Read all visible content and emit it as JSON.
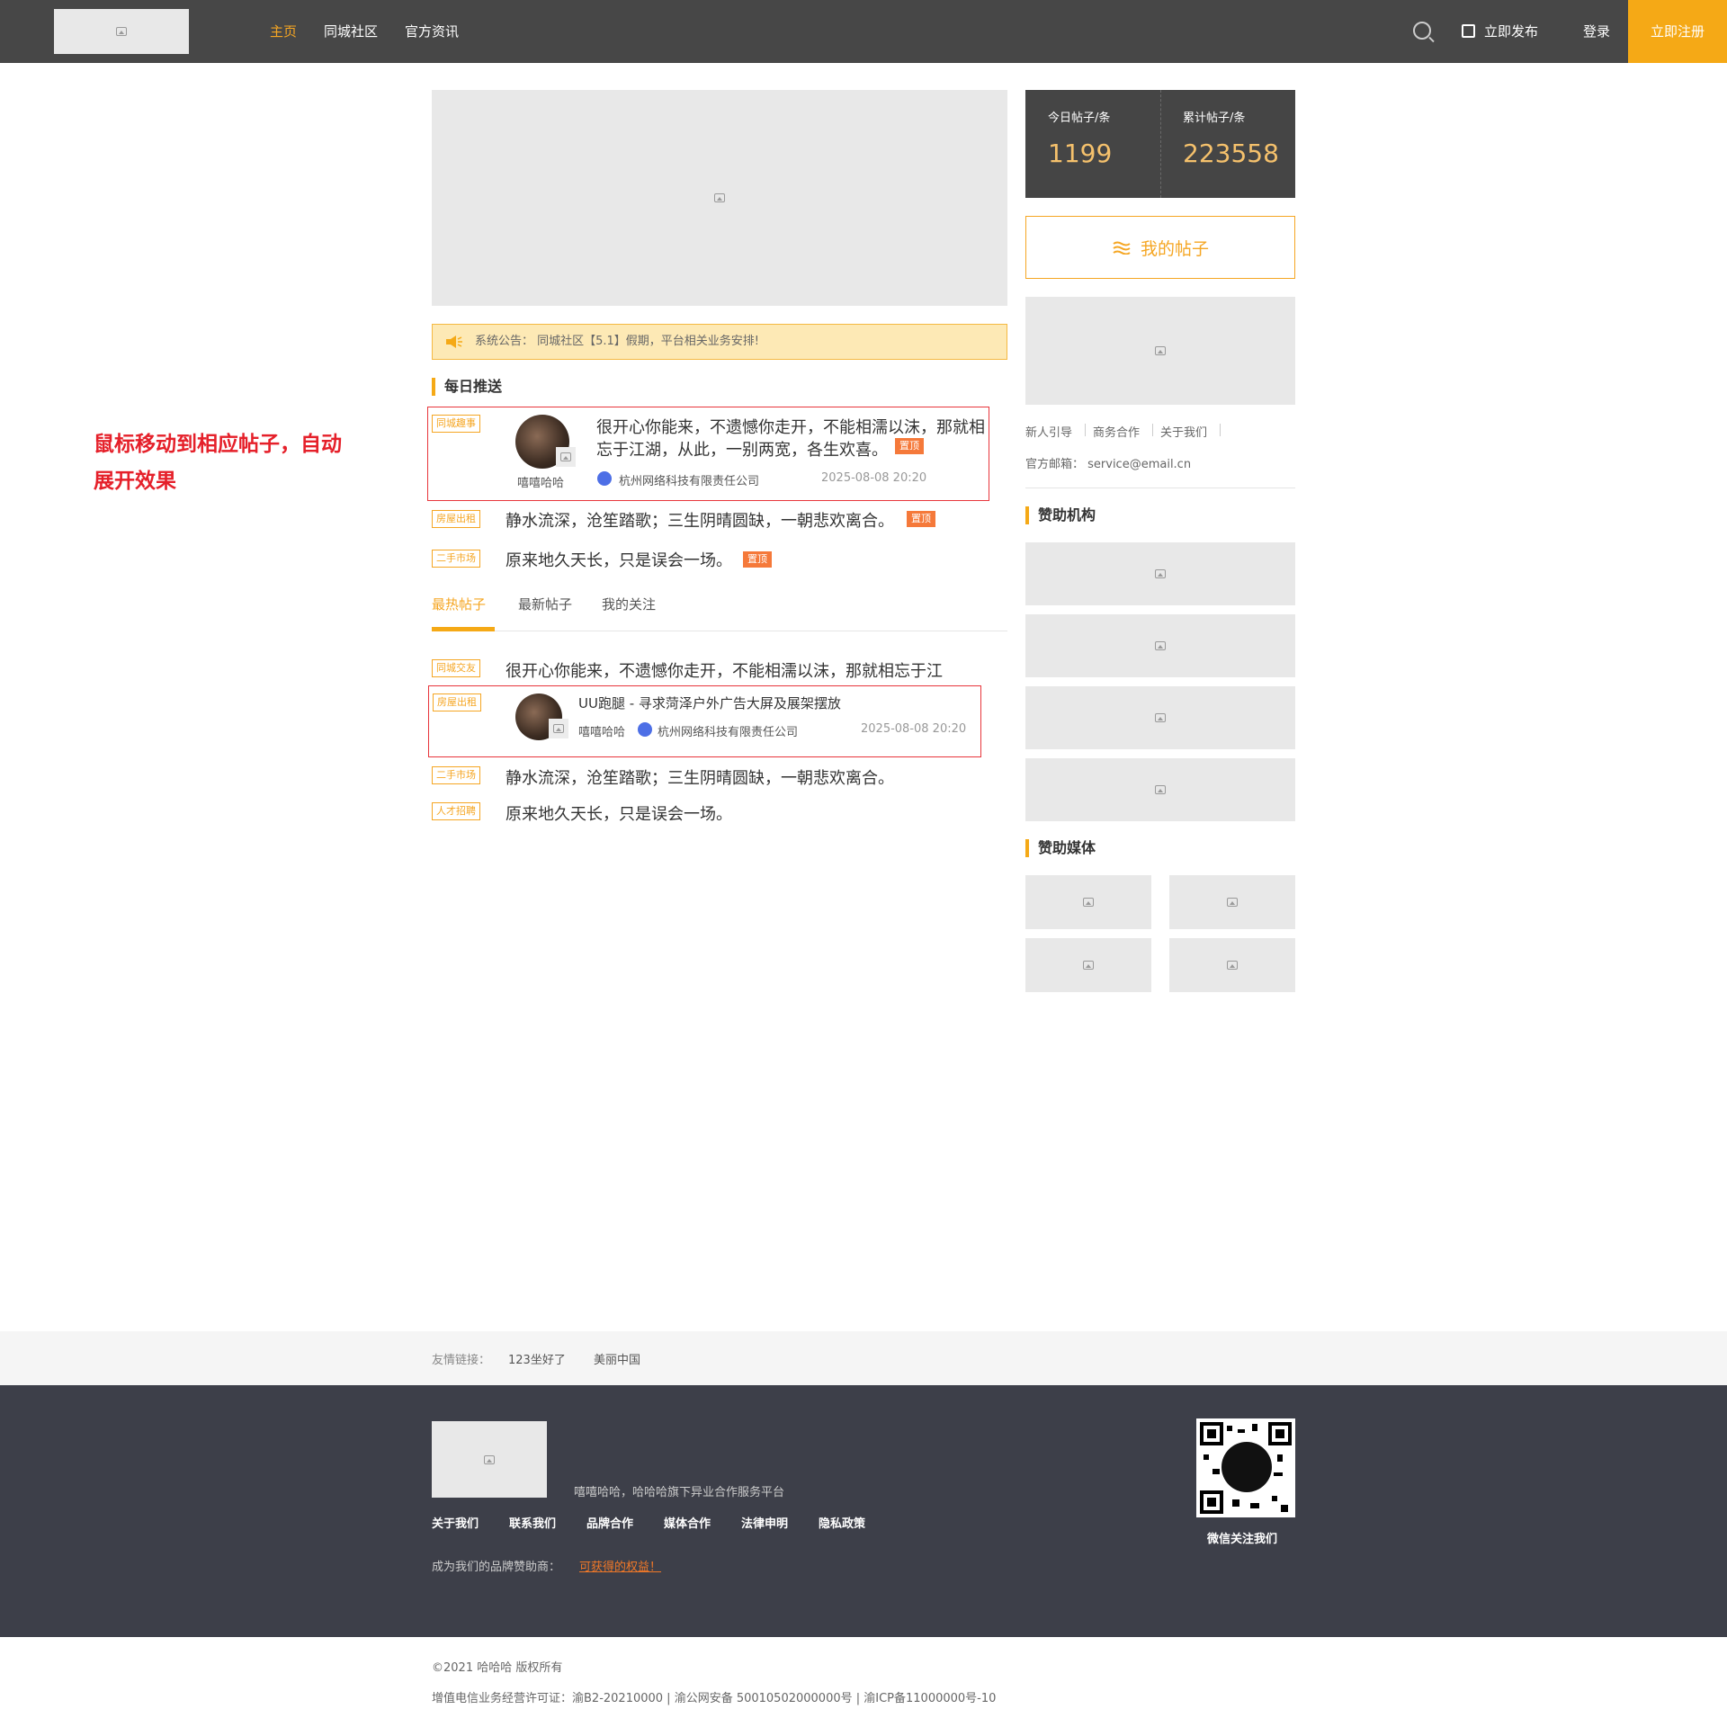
{
  "header": {
    "nav": [
      "主页",
      "同城社区",
      "官方资讯"
    ],
    "publish": "立即发布",
    "login": "登录",
    "register": "立即注册"
  },
  "annotation": "鼠标移动到相应帖子，自动展开效果",
  "notice": "系统公告：  同城社区【5.1】假期，平台相关业务安排!",
  "daily": {
    "title": "每日推送",
    "expanded": {
      "tag": "同城趣事",
      "text_line1": "很开心你能来，不遗憾你走开，不能相濡以沫，那就相",
      "text_line2": "忘于江湖，从此，一别两宽，各生欢喜。",
      "badge": "置顶",
      "author": "嘻嘻哈哈",
      "company": "杭州网络科技有限责任公司",
      "time": "2025-08-08  20:20"
    },
    "items": [
      {
        "tag": "房屋出租",
        "text": "静水流深，沧笙踏歌；三生阴晴圆缺，一朝悲欢离合。",
        "badge": "置顶"
      },
      {
        "tag": "二手市场",
        "text": "原来地久天长，只是误会一场。",
        "badge": "置顶"
      }
    ]
  },
  "tabs": [
    "最热帖子",
    "最新帖子",
    "我的关注"
  ],
  "hot": {
    "item1": {
      "tag": "同城交友",
      "text": "很开心你能来，不遗憾你走开，不能相濡以沫，那就相忘于江"
    },
    "expanded": {
      "tag": "房屋出租",
      "title": "UU跑腿 - 寻求菏泽户外广告大屏及展架摆放",
      "author": "嘻嘻哈哈",
      "company": "杭州网络科技有限责任公司",
      "time": "2025-08-08  20:20"
    },
    "item3": {
      "tag": "二手市场",
      "text": "静水流深，沧笙踏歌；三生阴晴圆缺，一朝悲欢离合。"
    },
    "item4": {
      "tag": "人才招聘",
      "text": "原来地久天长，只是误会一场。"
    }
  },
  "stats": {
    "today_label": "今日帖子/条",
    "today_value": "1199",
    "total_label": "累计帖子/条",
    "total_value": "223558"
  },
  "my_posts": "我的帖子",
  "side_links": [
    "新人引导",
    "商务合作",
    "关于我们"
  ],
  "email": "官方邮箱：  service@email.cn",
  "sponsors_title": "赞助机构",
  "media_title": "赞助媒体",
  "friend": {
    "label": "友情链接：",
    "links": [
      "123坐好了",
      "美丽中国"
    ]
  },
  "footer": {
    "slogan": "嘻嘻哈哈，哈哈哈旗下异业合作服务平台",
    "links": [
      "关于我们",
      "联系我们",
      "品牌合作",
      "媒体合作",
      "法律申明",
      "隐私政策"
    ],
    "sponsor_text": "成为我们的品牌赞助商：",
    "sponsor_link": "可获得的权益！",
    "qr_label": "微信关注我们"
  },
  "copyright": {
    "line1": "©2021 哈哈哈 版权所有",
    "line2": "增值电信业务经营许可证：渝B2-20210000  |  渝公网安备 50010502000000号  |  渝ICP备11000000号-10"
  },
  "colors": {
    "accent": "#f5a916",
    "header": "#474747",
    "footer": "#3d3f49",
    "highlight": "#e8353b",
    "badge": "#f5793a"
  }
}
